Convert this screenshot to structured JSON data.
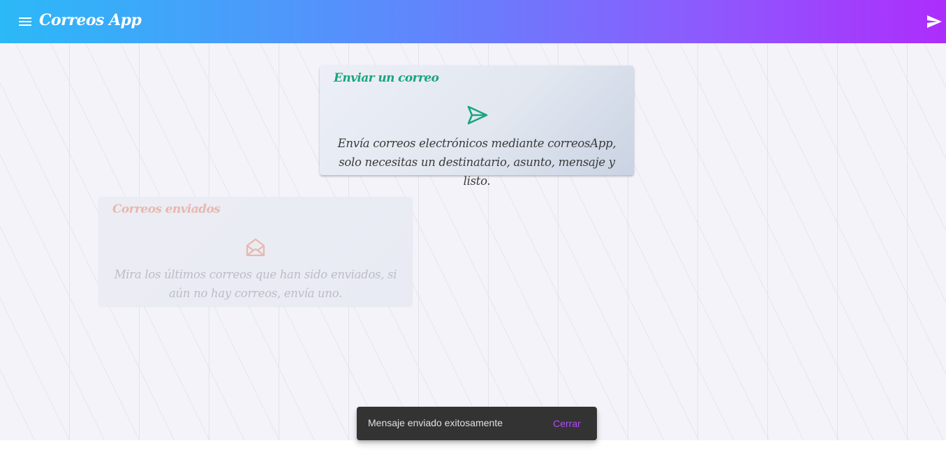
{
  "toolbar": {
    "title": "Correos App",
    "menu_icon": "menu-icon",
    "send_icon": "send-icon"
  },
  "cards": {
    "send": {
      "title": "Enviar un correo",
      "icon": "send-outline-icon",
      "description": "Envía correos electrónicos mediante correosApp, solo necesitas un destinatario, asunto, mensaje y listo."
    },
    "sent": {
      "title": "Correos enviados",
      "icon": "mail-open-icon",
      "description": "Mira los últimos correos que han sido enviados, si aún no hay correos, envía uno."
    }
  },
  "snackbar": {
    "message": "Mensaje enviado exitosamente",
    "action": "Cerrar"
  },
  "colors": {
    "toolbar_gradient_start": "#2bb9f7",
    "toolbar_gradient_end": "#ad2dfc",
    "send_card_title": "#1aa57e",
    "sent_card_title": "#e6b4a8",
    "snackbar_action": "#b24bfd"
  }
}
